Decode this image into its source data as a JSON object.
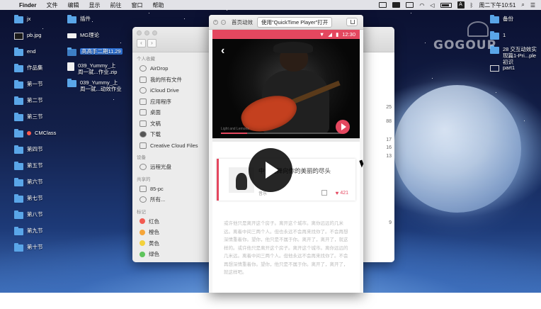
{
  "menubar": {
    "app": "Finder",
    "menus": [
      "文件",
      "编辑",
      "显示",
      "前往",
      "窗口",
      "帮助"
    ],
    "clock": "周二下午10:51",
    "input_method": "A"
  },
  "desktop": {
    "col1": [
      {
        "label": "jx",
        "icon": "folder-icon"
      },
      {
        "label": "pb.jpg",
        "icon": "image-file-icon"
      },
      {
        "label": "end",
        "icon": "folder-icon"
      },
      {
        "label": "作品集",
        "icon": "folder-icon"
      },
      {
        "label": "第一节",
        "icon": "folder-icon"
      },
      {
        "label": "第二节",
        "icon": "folder-icon"
      },
      {
        "label": "第三节",
        "icon": "folder-icon"
      },
      {
        "label": "CMClass",
        "icon": "folder-icon"
      },
      {
        "label": "第四节",
        "icon": "folder-icon"
      },
      {
        "label": "第五节",
        "icon": "folder-icon"
      },
      {
        "label": "第六节",
        "icon": "folder-icon"
      },
      {
        "label": "第七节",
        "icon": "folder-icon"
      },
      {
        "label": "第八节",
        "icon": "folder-icon"
      },
      {
        "label": "第九节",
        "icon": "folder-icon"
      },
      {
        "label": "第十节",
        "icon": "folder-icon"
      }
    ],
    "col2": [
      {
        "label": "插件",
        "icon": "folder-icon"
      },
      {
        "label": "MG理论",
        "icon": "doc-icon"
      },
      {
        "label": "高高手二期11.29",
        "icon": "folder-icon"
      },
      {
        "label": "039_Yummy_上周一就...作业.zip",
        "icon": "zip-file-icon"
      },
      {
        "label": "039_Yummy_上周一就...动效作业",
        "icon": "folder-icon"
      }
    ],
    "right": [
      {
        "label": "备份",
        "icon": "folder-icon"
      },
      {
        "label": "1",
        "icon": "folder-icon"
      },
      {
        "label": "28 交互动效实现篇1-Pri...ple初识",
        "icon": "folder-icon"
      },
      {
        "label": "part1",
        "icon": "recording-icon"
      }
    ]
  },
  "finder": {
    "sections": {
      "favorites": "个人收藏",
      "devices": "设备",
      "shared": "共享的",
      "tags": "标记"
    },
    "favorites": [
      "AirDrop",
      "我的所有文件",
      "iCloud Drive",
      "应用程序",
      "桌面",
      "文稿",
      "下载",
      "Creative Cloud Files"
    ],
    "devices": [
      "远程光盘"
    ],
    "shared": [
      "85-pc",
      "所有..."
    ],
    "tags": [
      {
        "label": "红色",
        "color": "#f25b52"
      },
      {
        "label": "橙色",
        "color": "#f5a53a"
      },
      {
        "label": "黄色",
        "color": "#f3d13c"
      },
      {
        "label": "绿色",
        "color": "#5ec45c"
      }
    ],
    "right_numbers": [
      "25",
      "88",
      "17",
      "16",
      "13",
      "9"
    ]
  },
  "phone": {
    "window_title": "首页动效",
    "open_with": "使用\"QuickTime Player\"打开",
    "status_time": "12:30",
    "video_caption": "Light and Lemons",
    "card": {
      "title": "中让我舞向你的美丽的尽头",
      "meta": "音乐",
      "likes": "421"
    },
    "body_text": "或许他只是离开这个房子。离开这个城市。离你远远的几米远。离着中间三两个人。但也永远不会再来找你了。不会再想深情重着你。望你，他只是不属于你。离开了，离开了，就这样的。或许他只是离开这个房子。离开这个城市。离你远远的几米远。离着中间三两个人。但他永远不会再来找你了。不会再想深情重着你。望你，他只是不属于你。离开了，离开了，就这样吧。"
  },
  "colors": {
    "accent": "#e4475f",
    "folder": "#5aa6e8"
  }
}
